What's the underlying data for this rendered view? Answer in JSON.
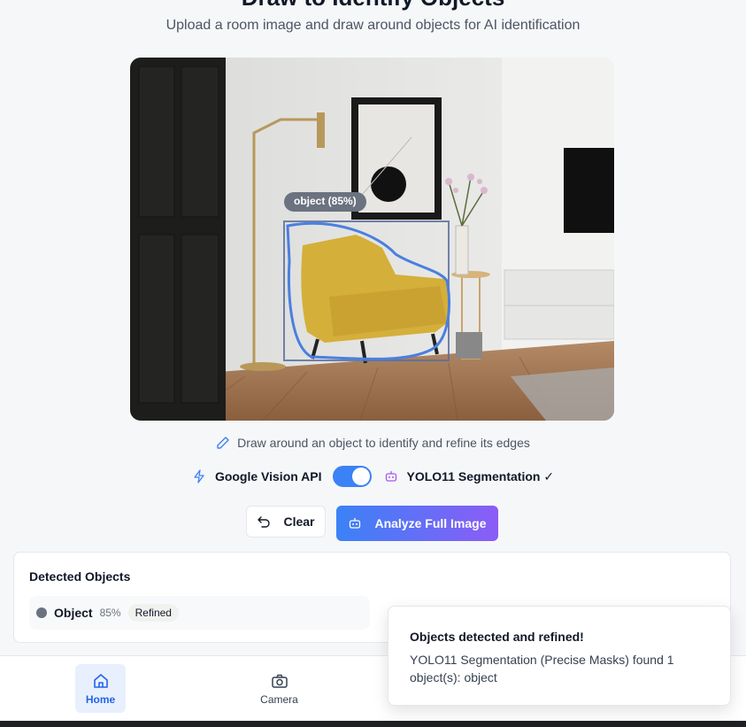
{
  "header": {
    "title": "Draw to Identify Objects",
    "subtitle": "Upload a room image and draw around objects for AI identification"
  },
  "canvas": {
    "detection_label": "object (85%)",
    "image_description_icon": "room-photo"
  },
  "hint": {
    "text": "Draw around an object to identify and refine its edges",
    "icon": "pencil-icon"
  },
  "mode_toggle": {
    "left_label": "Google Vision API",
    "right_label": "YOLO11 Segmentation ✓",
    "enabled": true,
    "accent_color": "#3b82f6"
  },
  "actions": {
    "clear_label": "Clear",
    "analyze_label": "Analyze Full Image"
  },
  "detected": {
    "title": "Detected Objects",
    "items": [
      {
        "name": "Object",
        "confidence": "85%",
        "badge": "Refined",
        "color": "#6b7280"
      }
    ]
  },
  "nav": {
    "items": [
      {
        "label": "Home",
        "icon": "home-icon",
        "active": true
      },
      {
        "label": "Camera",
        "icon": "camera-icon",
        "active": false
      }
    ]
  },
  "toast": {
    "title": "Objects detected and refined!",
    "body": "YOLO11 Segmentation (Precise Masks) found 1 object(s): object"
  }
}
